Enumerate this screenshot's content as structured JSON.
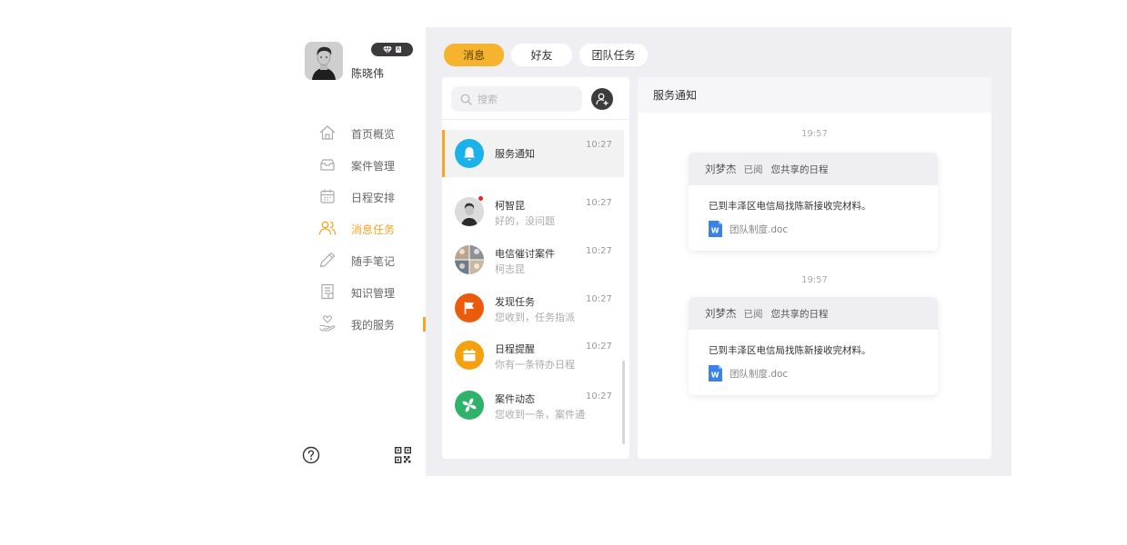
{
  "user": {
    "name": "陈晓伟",
    "badge_tag": "R"
  },
  "nav": {
    "items": [
      {
        "label": "首页概览",
        "icon": "home-icon"
      },
      {
        "label": "案件管理",
        "icon": "case-box-icon"
      },
      {
        "label": "日程安排",
        "icon": "calendar-icon"
      },
      {
        "label": "消息任务",
        "icon": "users-icon"
      },
      {
        "label": "随手笔记",
        "icon": "pencil-icon"
      },
      {
        "label": "知识管理",
        "icon": "document-icon"
      },
      {
        "label": "我的服务",
        "icon": "hand-heart-icon"
      }
    ],
    "active_index": 3
  },
  "tabs": [
    {
      "label": "消息"
    },
    {
      "label": "好友"
    },
    {
      "label": "团队任务"
    }
  ],
  "search": {
    "placeholder": "搜索"
  },
  "conversations": [
    {
      "name": "服务通知",
      "time": "10:27",
      "preview": "",
      "icon": "bell-icon",
      "color": "#1ab2e8"
    },
    {
      "name": "柯智昆",
      "time": "10:27",
      "preview": "好的，没问题",
      "icon": "person-avatar",
      "unread": true
    },
    {
      "name": "电信催讨案件",
      "time": "10:27",
      "preview": "柯志昆",
      "icon": "group-avatar"
    },
    {
      "name": "发现任务",
      "time": "10:27",
      "preview": "您收到，任务指派",
      "icon": "flag-icon",
      "color": "#ea5b0c"
    },
    {
      "name": "日程提醒",
      "time": "10:27",
      "preview": "你有一条待办日程",
      "icon": "calendar-icon",
      "color": "#f5a00f"
    },
    {
      "name": "案件动态",
      "time": "10:27",
      "preview": "您收到一条，案件通知",
      "icon": "pinwheel-icon",
      "color": "#2fb36b"
    }
  ],
  "chat": {
    "title": "服务通知",
    "messages": [
      {
        "time": "19:57",
        "sender": "刘梦杰",
        "status": "已阅",
        "description": "您共享的日程",
        "body": "已到丰泽区电信局找陈新接收完材料。",
        "attachment": "团队制度.doc"
      },
      {
        "time": "19:57",
        "sender": "刘梦杰",
        "status": "已阅",
        "description": "您共享的日程",
        "body": "已到丰泽区电信局找陈新接收完材料。",
        "attachment": "团队制度.doc"
      }
    ]
  },
  "colors": {
    "accent": "#f5a623",
    "tab_active": "#f5b32e",
    "background": "#efeff3"
  }
}
